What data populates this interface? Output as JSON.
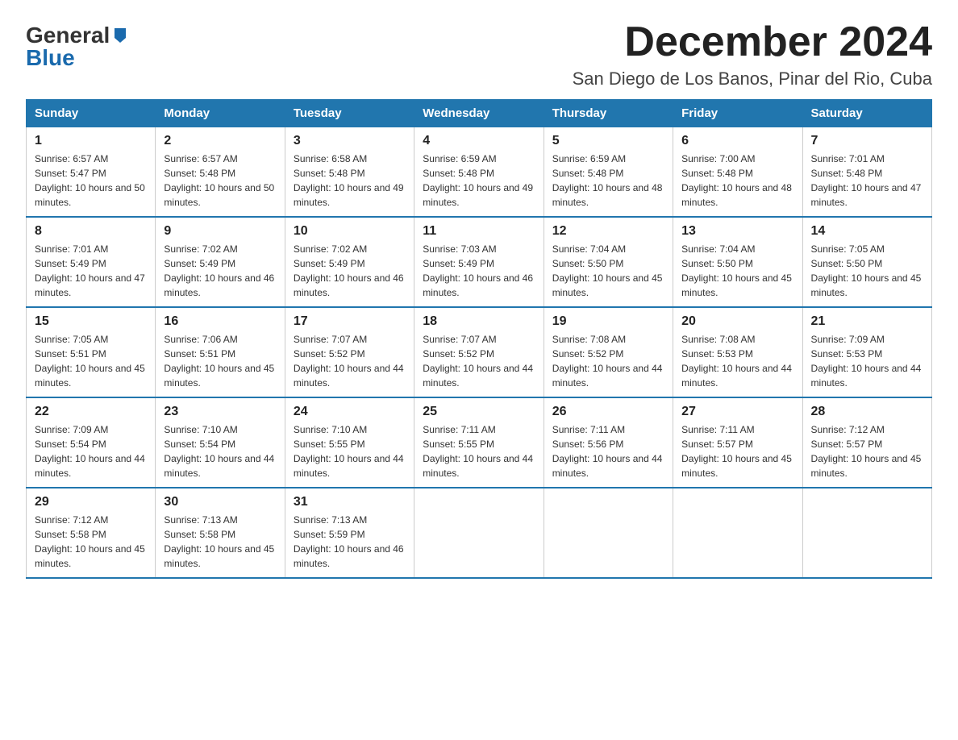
{
  "header": {
    "logo_general": "General",
    "logo_blue": "Blue",
    "month_title": "December 2024",
    "location": "San Diego de Los Banos, Pinar del Rio, Cuba"
  },
  "days_of_week": [
    "Sunday",
    "Monday",
    "Tuesday",
    "Wednesday",
    "Thursday",
    "Friday",
    "Saturday"
  ],
  "weeks": [
    [
      {
        "day": "1",
        "sunrise": "6:57 AM",
        "sunset": "5:47 PM",
        "daylight": "10 hours and 50 minutes."
      },
      {
        "day": "2",
        "sunrise": "6:57 AM",
        "sunset": "5:48 PM",
        "daylight": "10 hours and 50 minutes."
      },
      {
        "day": "3",
        "sunrise": "6:58 AM",
        "sunset": "5:48 PM",
        "daylight": "10 hours and 49 minutes."
      },
      {
        "day": "4",
        "sunrise": "6:59 AM",
        "sunset": "5:48 PM",
        "daylight": "10 hours and 49 minutes."
      },
      {
        "day": "5",
        "sunrise": "6:59 AM",
        "sunset": "5:48 PM",
        "daylight": "10 hours and 48 minutes."
      },
      {
        "day": "6",
        "sunrise": "7:00 AM",
        "sunset": "5:48 PM",
        "daylight": "10 hours and 48 minutes."
      },
      {
        "day": "7",
        "sunrise": "7:01 AM",
        "sunset": "5:48 PM",
        "daylight": "10 hours and 47 minutes."
      }
    ],
    [
      {
        "day": "8",
        "sunrise": "7:01 AM",
        "sunset": "5:49 PM",
        "daylight": "10 hours and 47 minutes."
      },
      {
        "day": "9",
        "sunrise": "7:02 AM",
        "sunset": "5:49 PM",
        "daylight": "10 hours and 46 minutes."
      },
      {
        "day": "10",
        "sunrise": "7:02 AM",
        "sunset": "5:49 PM",
        "daylight": "10 hours and 46 minutes."
      },
      {
        "day": "11",
        "sunrise": "7:03 AM",
        "sunset": "5:49 PM",
        "daylight": "10 hours and 46 minutes."
      },
      {
        "day": "12",
        "sunrise": "7:04 AM",
        "sunset": "5:50 PM",
        "daylight": "10 hours and 45 minutes."
      },
      {
        "day": "13",
        "sunrise": "7:04 AM",
        "sunset": "5:50 PM",
        "daylight": "10 hours and 45 minutes."
      },
      {
        "day": "14",
        "sunrise": "7:05 AM",
        "sunset": "5:50 PM",
        "daylight": "10 hours and 45 minutes."
      }
    ],
    [
      {
        "day": "15",
        "sunrise": "7:05 AM",
        "sunset": "5:51 PM",
        "daylight": "10 hours and 45 minutes."
      },
      {
        "day": "16",
        "sunrise": "7:06 AM",
        "sunset": "5:51 PM",
        "daylight": "10 hours and 45 minutes."
      },
      {
        "day": "17",
        "sunrise": "7:07 AM",
        "sunset": "5:52 PM",
        "daylight": "10 hours and 44 minutes."
      },
      {
        "day": "18",
        "sunrise": "7:07 AM",
        "sunset": "5:52 PM",
        "daylight": "10 hours and 44 minutes."
      },
      {
        "day": "19",
        "sunrise": "7:08 AM",
        "sunset": "5:52 PM",
        "daylight": "10 hours and 44 minutes."
      },
      {
        "day": "20",
        "sunrise": "7:08 AM",
        "sunset": "5:53 PM",
        "daylight": "10 hours and 44 minutes."
      },
      {
        "day": "21",
        "sunrise": "7:09 AM",
        "sunset": "5:53 PM",
        "daylight": "10 hours and 44 minutes."
      }
    ],
    [
      {
        "day": "22",
        "sunrise": "7:09 AM",
        "sunset": "5:54 PM",
        "daylight": "10 hours and 44 minutes."
      },
      {
        "day": "23",
        "sunrise": "7:10 AM",
        "sunset": "5:54 PM",
        "daylight": "10 hours and 44 minutes."
      },
      {
        "day": "24",
        "sunrise": "7:10 AM",
        "sunset": "5:55 PM",
        "daylight": "10 hours and 44 minutes."
      },
      {
        "day": "25",
        "sunrise": "7:11 AM",
        "sunset": "5:55 PM",
        "daylight": "10 hours and 44 minutes."
      },
      {
        "day": "26",
        "sunrise": "7:11 AM",
        "sunset": "5:56 PM",
        "daylight": "10 hours and 44 minutes."
      },
      {
        "day": "27",
        "sunrise": "7:11 AM",
        "sunset": "5:57 PM",
        "daylight": "10 hours and 45 minutes."
      },
      {
        "day": "28",
        "sunrise": "7:12 AM",
        "sunset": "5:57 PM",
        "daylight": "10 hours and 45 minutes."
      }
    ],
    [
      {
        "day": "29",
        "sunrise": "7:12 AM",
        "sunset": "5:58 PM",
        "daylight": "10 hours and 45 minutes."
      },
      {
        "day": "30",
        "sunrise": "7:13 AM",
        "sunset": "5:58 PM",
        "daylight": "10 hours and 45 minutes."
      },
      {
        "day": "31",
        "sunrise": "7:13 AM",
        "sunset": "5:59 PM",
        "daylight": "10 hours and 46 minutes."
      },
      null,
      null,
      null,
      null
    ]
  ]
}
